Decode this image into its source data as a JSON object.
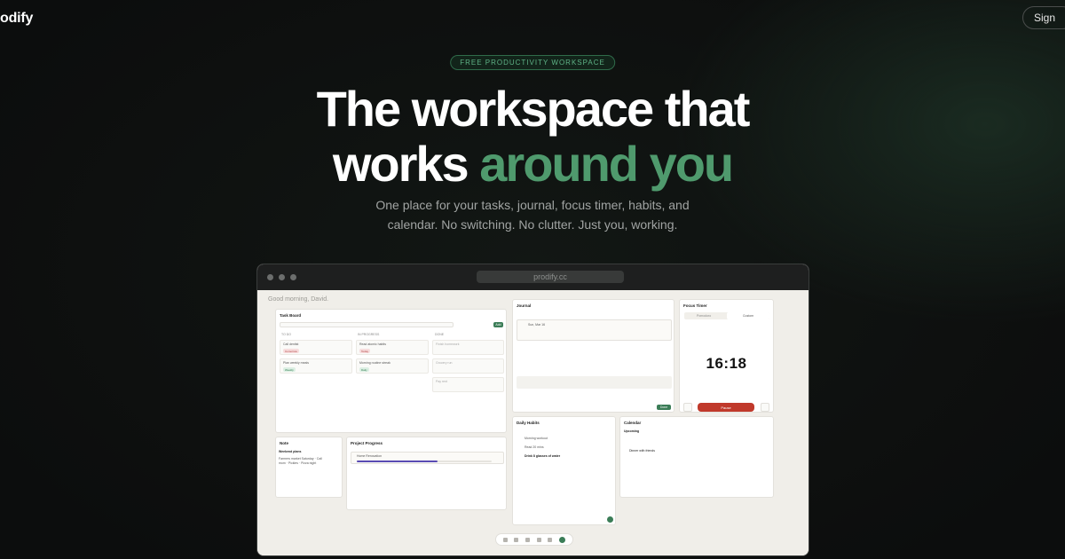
{
  "nav": {
    "logo": "odify",
    "sign_label": "Sign"
  },
  "hero": {
    "badge": "FREE PRODUCTIVITY WORKSPACE",
    "title_line1": "The workspace that",
    "title_line2_plain": "works ",
    "title_line2_accent": "around you",
    "subtitle_line1": "One place for your tasks, journal, focus timer, habits, and",
    "subtitle_line2": "calendar. No switching. No clutter. Just you, working."
  },
  "app": {
    "url": "prodify.cc",
    "greeting": "Good morning, David.",
    "task_board": {
      "title": "Task Board",
      "add_label": "Add",
      "columns": [
        "TO DO",
        "IN PROGRESS",
        "DONE"
      ],
      "todo": [
        {
          "title": "Call dentist",
          "tag": "Comorrow"
        },
        {
          "title": "Plan weekly meals",
          "tag": "Weekly"
        }
      ],
      "in_progress": [
        {
          "title": "Read atomic habits",
          "tag": "Today"
        },
        {
          "title": "Morning routine streak",
          "tag": "Daily"
        }
      ],
      "done": [
        "Finish homework",
        "Grocery run",
        "Pay rent"
      ]
    },
    "journal": {
      "title": "Journal",
      "entry_date": "Sun, Mar 16",
      "save_label": "Done"
    },
    "focus": {
      "title": "Focus Timer",
      "tab_a": "Pomodoro",
      "tab_b": "Custom",
      "time": "16:18",
      "pause_label": "Pause"
    },
    "note": {
      "title": "Note",
      "heading": "Weekend plans",
      "body_line1": "Farmers market Saturday · Call",
      "body_line2": "mom · Pickles · Pizza night"
    },
    "project": {
      "title": "Project Progress",
      "item": "Home Renovation",
      "fraction": 0.6
    },
    "habits": {
      "title": "Daily Habits",
      "items": [
        "Morning workout",
        "Read 20 mins",
        "Drink 8 glasses of water"
      ]
    },
    "calendar": {
      "title": "Calendar",
      "section": "Upcoming",
      "event": "Dinner with friends"
    }
  }
}
